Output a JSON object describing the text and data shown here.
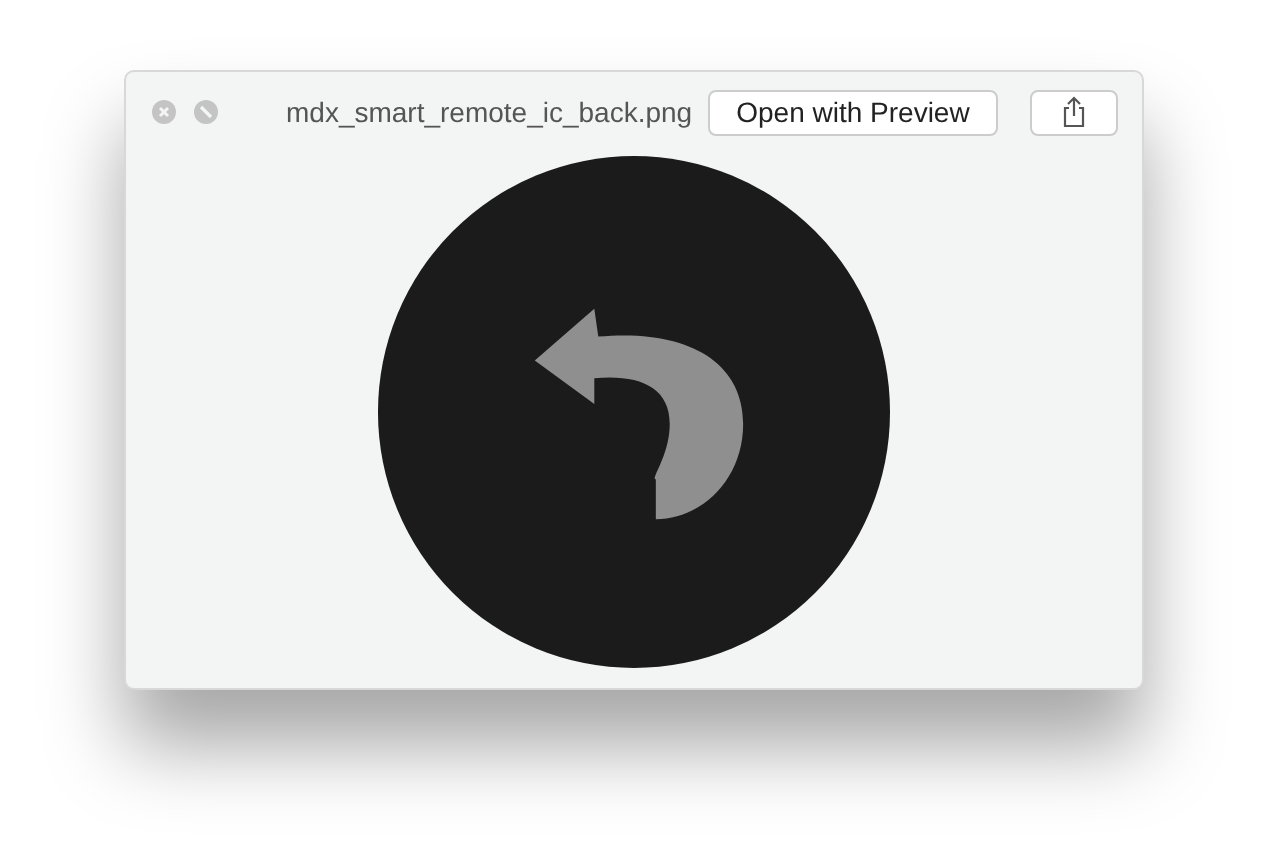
{
  "window": {
    "title": "mdx_smart_remote_ic_back.png"
  },
  "toolbar": {
    "open_button": "Open with Preview"
  }
}
